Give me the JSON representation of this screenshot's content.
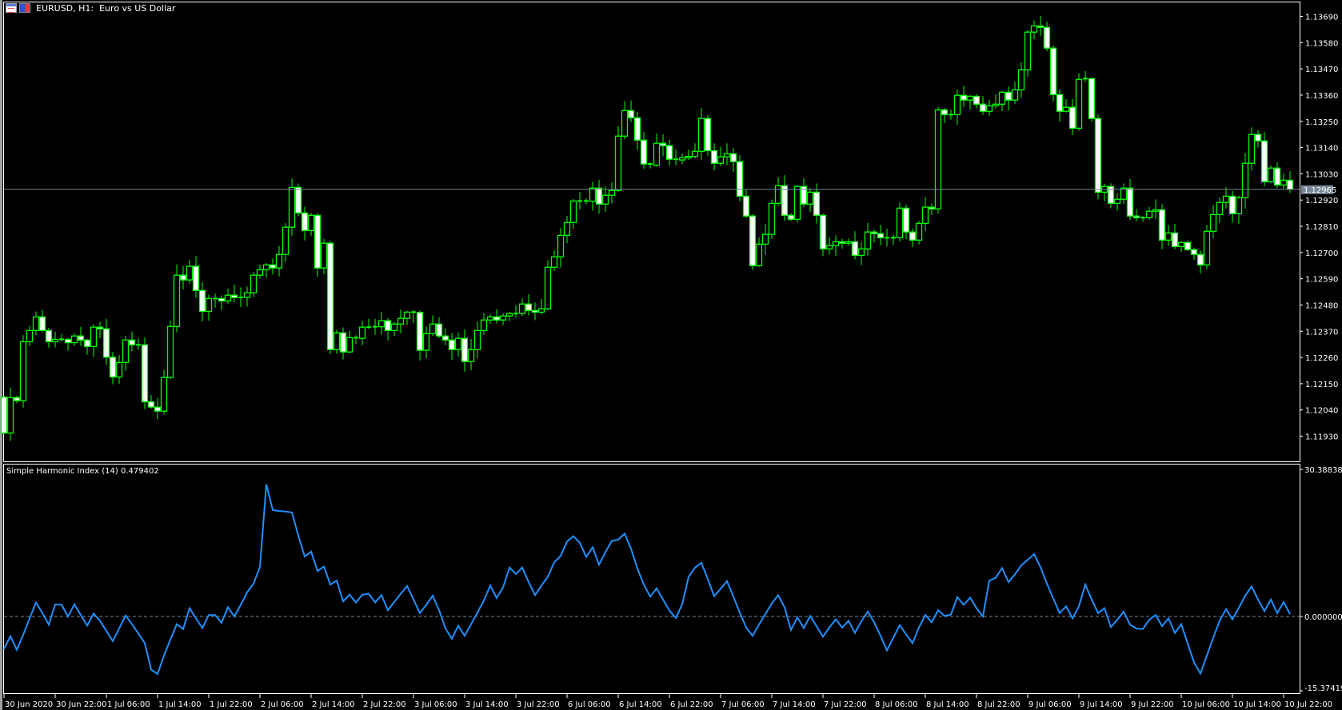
{
  "window": {
    "title": "EURUSD, H1:  Euro vs US Dollar",
    "icons": [
      "chart-window-icon",
      "symbol-flag-icon"
    ]
  },
  "colors": {
    "background": "#000000",
    "frame": "#ffffff",
    "candle_outline": "#00ff00",
    "bear_body": "#ffffff",
    "bull_body": "#000000",
    "bid_line": "#778899",
    "indicator_line": "#1e90ff",
    "zero_line": "#778899"
  },
  "price_axis": {
    "labels": [
      "1.13690",
      "1.13580",
      "1.13470",
      "1.13360",
      "1.13250",
      "1.13140",
      "1.13030",
      "1.12920",
      "1.12810",
      "1.12700",
      "1.12590",
      "1.12480",
      "1.12370",
      "1.12260",
      "1.12150",
      "1.12040",
      "1.11930"
    ],
    "current_price": "1.12965"
  },
  "indicator": {
    "title": "Simple Harmonic Index (14) 0.479402",
    "axis_labels": {
      "max": "30.388387",
      "zero": "0.000000",
      "min": "-15.374197"
    }
  },
  "time_axis": {
    "labels": [
      "30 Jun 2020",
      "30 Jun 22:00",
      "1 Jul 06:00",
      "1 Jul 14:00",
      "1 Jul 22:00",
      "2 Jul 06:00",
      "2 Jul 14:00",
      "2 Jul 22:00",
      "3 Jul 06:00",
      "3 Jul 14:00",
      "3 Jul 22:00",
      "6 Jul 06:00",
      "6 Jul 14:00",
      "6 Jul 22:00",
      "7 Jul 06:00",
      "7 Jul 14:00",
      "7 Jul 22:00",
      "8 Jul 06:00",
      "8 Jul 14:00",
      "8 Jul 22:00",
      "9 Jul 06:00",
      "9 Jul 14:00",
      "9 Jul 22:00",
      "10 Jul 06:00",
      "10 Jul 14:00",
      "10 Jul 22:00"
    ]
  },
  "chart_data": [
    {
      "type": "candlestick",
      "symbol": "EURUSD",
      "timeframe": "H1",
      "title": "EURUSD, H1:  Euro vs US Dollar",
      "ylim": [
        1.118,
        1.1375
      ],
      "first_open": 1.12094,
      "closes": [
        1.11943,
        1.12092,
        1.12079,
        1.12326,
        1.12373,
        1.1243,
        1.12373,
        1.12326,
        1.12336,
        1.12336,
        1.12322,
        1.1235,
        1.12333,
        1.12306,
        1.12387,
        1.1238,
        1.12261,
        1.12178,
        1.12239,
        1.12333,
        1.12313,
        1.12313,
        1.12074,
        1.12052,
        1.12035,
        1.12176,
        1.1239,
        1.12605,
        1.12585,
        1.12642,
        1.12541,
        1.12453,
        1.12507,
        1.12507,
        1.12497,
        1.12521,
        1.12511,
        1.12512,
        1.12531,
        1.12605,
        1.12628,
        1.12648,
        1.12635,
        1.12692,
        1.12806,
        1.12973,
        1.12866,
        1.12792,
        1.12856,
        1.12635,
        1.12739,
        1.12293,
        1.12363,
        1.12283,
        1.12343,
        1.1234,
        1.12387,
        1.12387,
        1.12389,
        1.12414,
        1.12373,
        1.124,
        1.12424,
        1.1245,
        1.12449,
        1.1229,
        1.1236,
        1.124,
        1.1235,
        1.12333,
        1.12293,
        1.1234,
        1.12243,
        1.12293,
        1.12373,
        1.12417,
        1.1243,
        1.12417,
        1.12434,
        1.12444,
        1.12444,
        1.12484,
        1.12457,
        1.1245,
        1.12464,
        1.12638,
        1.12682,
        1.12772,
        1.12826,
        1.12916,
        1.12916,
        1.12915,
        1.1297,
        1.12903,
        1.1294,
        1.1296,
        1.13188,
        1.13295,
        1.13265,
        1.13171,
        1.13071,
        1.13066,
        1.13158,
        1.13148,
        1.13091,
        1.13088,
        1.13097,
        1.13103,
        1.13124,
        1.13262,
        1.13127,
        1.13074,
        1.13101,
        1.13114,
        1.13081,
        1.12936,
        1.12853,
        1.12645,
        1.12735,
        1.12776,
        1.12906,
        1.1298,
        1.12856,
        1.12839,
        1.12977,
        1.12903,
        1.12953,
        1.12856,
        1.12715,
        1.12729,
        1.12745,
        1.12739,
        1.12745,
        1.12688,
        1.12715,
        1.12786,
        1.12779,
        1.12762,
        1.12759,
        1.12762,
        1.12886,
        1.12786,
        1.12752,
        1.12822,
        1.1289,
        1.12883,
        1.13298,
        1.13278,
        1.13278,
        1.13359,
        1.13339,
        1.13355,
        1.13322,
        1.13292,
        1.13315,
        1.13322,
        1.13372,
        1.13339,
        1.13382,
        1.13466,
        1.13624,
        1.1365,
        1.13644,
        1.13557,
        1.13362,
        1.13292,
        1.13309,
        1.13221,
        1.13426,
        1.13429,
        1.13262,
        1.12953,
        1.12977,
        1.12906,
        1.12923,
        1.1297,
        1.12853,
        1.12846,
        1.12846,
        1.12873,
        1.12879,
        1.12752,
        1.12782,
        1.12725,
        1.12742,
        1.12712,
        1.12692,
        1.12648,
        1.12789,
        1.12859,
        1.1291,
        1.12936,
        1.12863,
        1.1293,
        1.13074,
        1.13195,
        1.13168,
        1.12997,
        1.13054,
        1.12983,
        1.13003,
        1.12965
      ],
      "current_price": 1.12965
    },
    {
      "type": "line",
      "title": "Simple Harmonic Index (14) 0.479402",
      "ylim": [
        -15.374197,
        30.388387
      ],
      "zero_line": 0,
      "values": [
        -6.7,
        -4.1,
        -6.9,
        -3.8,
        -0.4,
        2.9,
        0.7,
        -1.7,
        2.5,
        2.4,
        0,
        2.5,
        0.3,
        -1.9,
        0.6,
        -0.9,
        -3.0,
        -5.1,
        -2.5,
        0.2,
        -1.6,
        -3.5,
        -5.5,
        -11.0,
        -11.9,
        -8.1,
        -4.8,
        -1.6,
        -2.6,
        1.7,
        -0.4,
        -2.4,
        0.3,
        0.3,
        -1.3,
        1.9,
        0,
        2.4,
        5.0,
        6.8,
        10.2,
        27.3,
        22.0,
        21.8,
        21.7,
        21.5,
        16.7,
        12.4,
        13.4,
        9.4,
        10.3,
        6.6,
        7.4,
        3.1,
        4.5,
        2.9,
        4.5,
        4.7,
        2.9,
        4.4,
        1.3,
        3.0,
        4.7,
        6.3,
        3.5,
        0.7,
        2.4,
        4.3,
        1.3,
        -2.5,
        -4.6,
        -1.9,
        -4.0,
        -1.6,
        0.8,
        3.3,
        6.4,
        3.8,
        6.0,
        10.1,
        8.8,
        10.1,
        7.1,
        4.4,
        6.4,
        8.2,
        11.2,
        12.5,
        15.5,
        16.6,
        15.2,
        12.3,
        14.3,
        10.7,
        13.3,
        15.6,
        15.9,
        17.1,
        14.0,
        9.9,
        6.6,
        4.1,
        5.8,
        3.5,
        1.2,
        -0.3,
        2.5,
        8.2,
        10.1,
        11.1,
        7.7,
        4.2,
        5.7,
        7.3,
        4.1,
        0.8,
        -2.3,
        -4.0,
        -1.7,
        0.5,
        2.7,
        4.4,
        1.9,
        -2.8,
        -0.2,
        -2.4,
        0.1,
        -2.0,
        -4.2,
        -2.3,
        -0.6,
        -2.3,
        -0.9,
        -3.4,
        -1.0,
        1.0,
        -1.2,
        -4.0,
        -7.0,
        -4.4,
        -1.8,
        -3.7,
        -5.5,
        -2.3,
        0.3,
        -1.2,
        1.3,
        0.1,
        0.4,
        4.0,
        2.4,
        3.9,
        1.7,
        0,
        7.4,
        8.0,
        10.0,
        7.1,
        8.7,
        10.6,
        11.7,
        12.9,
        10.2,
        6.8,
        3.7,
        0.7,
        2.1,
        -0.4,
        2.1,
        6.6,
        3.5,
        0.7,
        1.7,
        -2.2,
        -0.7,
        1.0,
        -1.7,
        -2.5,
        -2.6,
        -0.7,
        0.3,
        -2.0,
        -0.4,
        -3.4,
        -1.6,
        -5.6,
        -9.5,
        -11.8,
        -8.1,
        -4.4,
        -0.9,
        1.5,
        -0.6,
        1.8,
        4.3,
        6.2,
        3.5,
        1.1,
        3.5,
        0.7,
        3.0,
        0.48
      ]
    }
  ]
}
